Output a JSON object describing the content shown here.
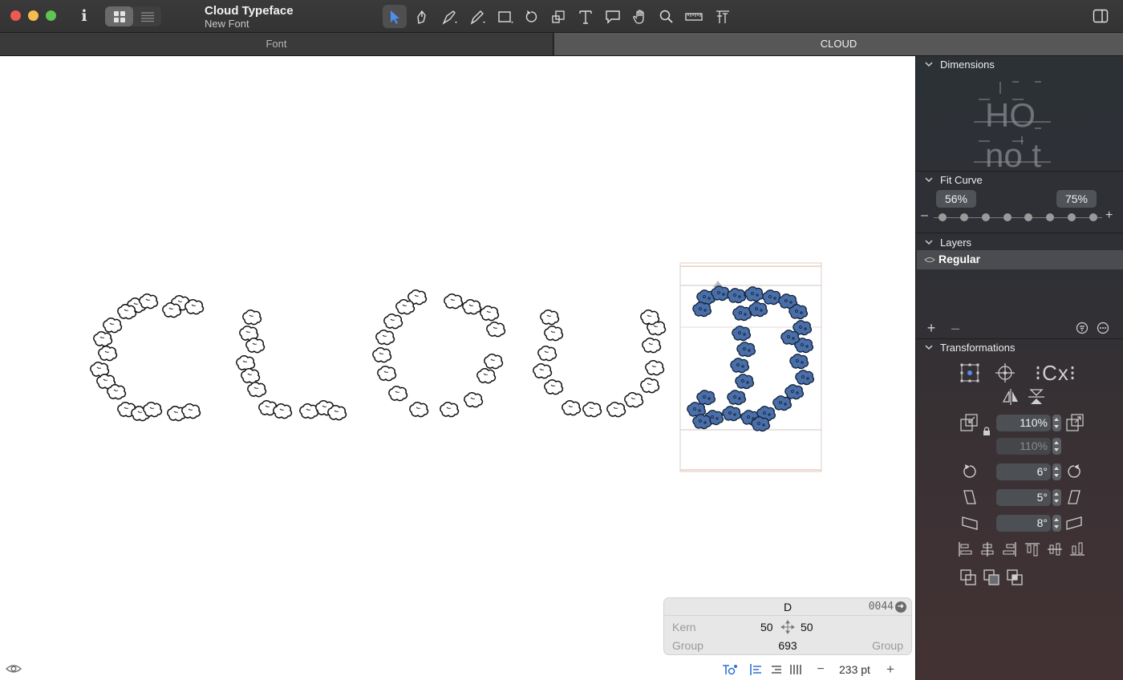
{
  "window": {
    "title": "Cloud Typeface",
    "subtitle": "New Font",
    "controls": [
      "close",
      "minimize",
      "zoom"
    ]
  },
  "toolbar": {
    "tools": [
      "select-tool-icon",
      "draw-tool-icon",
      "pen-tool-icon",
      "pencil-tool-icon",
      "rectangle-tool-icon",
      "rotate-tool-icon",
      "scale-tool-icon",
      "text-tool-icon",
      "annotation-tool-icon",
      "hand-tool-icon",
      "zoom-tool-icon",
      "measure-tool-icon",
      "metrics-tool-icon"
    ]
  },
  "tabs": [
    {
      "label": "Font",
      "active": false
    },
    {
      "label": "CLOUD",
      "active": true
    }
  ],
  "glyph_info": {
    "name": "D",
    "unicode": "0044",
    "kern_label": "Kern",
    "kern_left": "50",
    "kern_right": "50",
    "group_label": "Group",
    "group_value": "693",
    "group_right_label": "Group"
  },
  "footer": {
    "zoom": "233 pt",
    "zoom_out": "−",
    "zoom_in": "+"
  },
  "inspector": {
    "dimensions": {
      "title": "Dimensions",
      "preview_line1": "HO",
      "preview_line2": "no t"
    },
    "fit_curve": {
      "title": "Fit Curve",
      "min": "56%",
      "max": "75%",
      "steps": 8
    },
    "layers": {
      "title": "Layers",
      "items": [
        {
          "name": "Regular",
          "selected": true
        }
      ]
    },
    "transformations": {
      "title": "Transformations",
      "scale_x": "110%",
      "scale_y": "110%",
      "rotate": "6°",
      "slant": "5°",
      "slant_vertical": "8°"
    }
  },
  "colors": {
    "accent": "#2e6fd6",
    "glyph_fill": "#4a6fa8",
    "titlebar": "#383737",
    "inspector": "#2f3035"
  }
}
